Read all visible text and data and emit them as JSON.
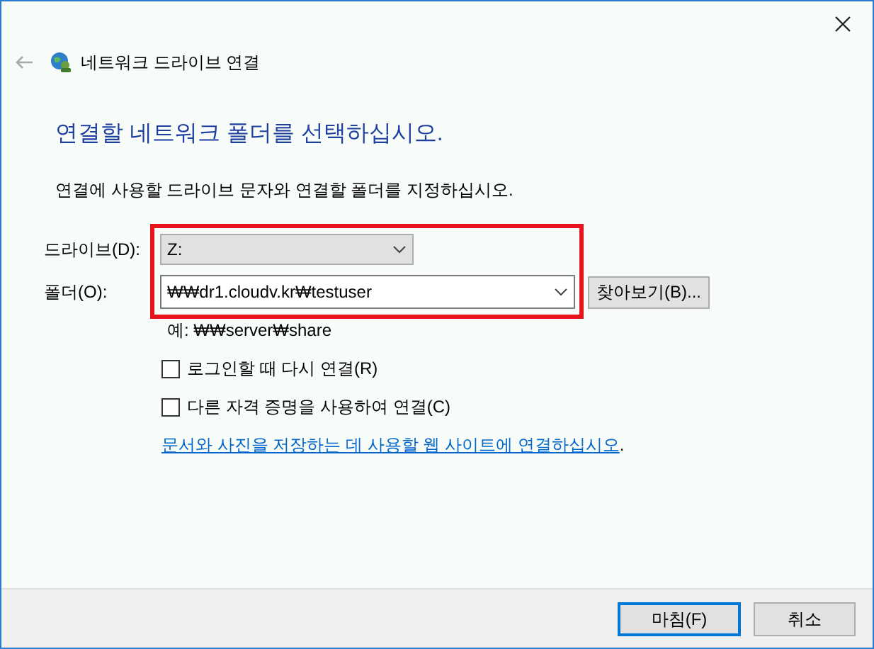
{
  "window": {
    "title": "네트워크 드라이브 연결"
  },
  "heading": "연결할 네트워크 폴더를 선택하십시오.",
  "instruction": "연결에 사용할 드라이브 문자와 연결할 폴더를 지정하십시오.",
  "drive": {
    "label": "드라이브(D):",
    "value": "Z:"
  },
  "folder": {
    "label": "폴더(O):",
    "value": "₩₩dr1.cloudv.kr₩testuser",
    "browse": "찾아보기(B)..."
  },
  "example": "예: ₩₩server₩share",
  "options": [
    {
      "label": "로그인할 때 다시 연결(R)",
      "checked": false
    },
    {
      "label": "다른 자격 증명을 사용하여 연결(C)",
      "checked": false
    }
  ],
  "link": {
    "text": "문서와 사진을 저장하는 데 사용할 웹 사이트에 연결하십시오",
    "suffix": "."
  },
  "highlight": true,
  "buttons": [
    {
      "label": "마침(F)",
      "default": true
    },
    {
      "label": "취소",
      "default": false
    }
  ]
}
